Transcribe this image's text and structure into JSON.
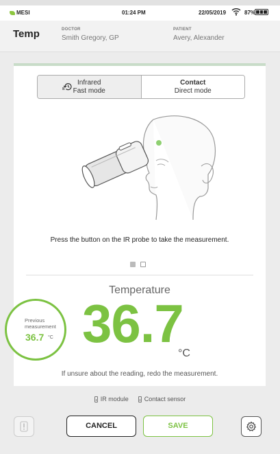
{
  "status_bar": {
    "brand": "MESI",
    "time": "01:24 PM",
    "date": "22/05/2019",
    "battery": "87%",
    "wifi_icon": "wifi-icon",
    "battery_icon": "battery-icon"
  },
  "header": {
    "title": "Temp",
    "doctor_label": "DOCTOR",
    "doctor_name": "Smith Gregory, GP",
    "patient_label": "PATIENT",
    "patient_name": "Avery, Alexander"
  },
  "modes": [
    {
      "line1": "Infrared",
      "line2": "Fast mode",
      "icon": "history-icon",
      "active": false
    },
    {
      "line1": "Contact",
      "line2": "Direct mode",
      "active": true
    }
  ],
  "instruction": "Press the button on the IR probe to take the measurement.",
  "pager": {
    "count": 2,
    "current": 1
  },
  "measurement": {
    "label": "Temperature",
    "value": "36.7",
    "unit": "°C",
    "advice": "If unsure about the reading, redo the measurement."
  },
  "previous": {
    "label_line1": "Previous",
    "label_line2": "measurement",
    "value": "36.7",
    "unit": "°C"
  },
  "modules": {
    "ir": "IR module",
    "contact": "Contact sensor"
  },
  "buttons": {
    "cancel": "CANCEL",
    "save": "SAVE",
    "alert_icon": "alert-icon",
    "settings_icon": "gear-icon"
  },
  "colors": {
    "accent": "#7cc242",
    "card_top_border": "#c8dcc8",
    "background": "#ececec"
  }
}
